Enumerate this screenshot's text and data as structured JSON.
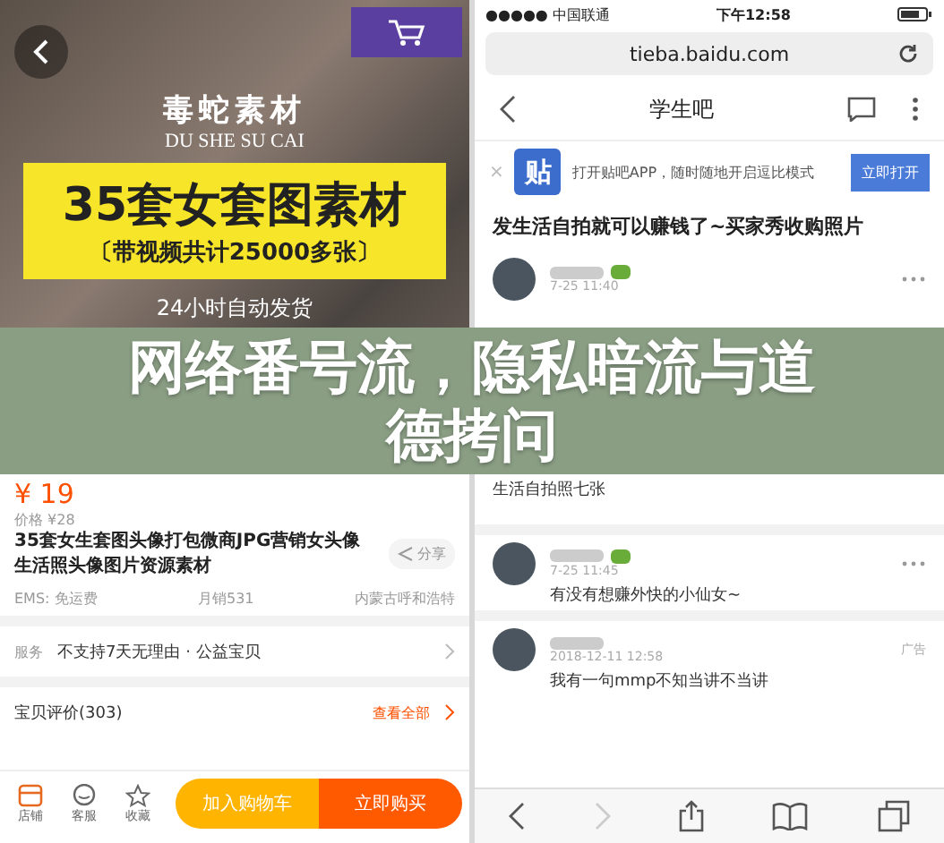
{
  "left_screen": {
    "hero": {
      "brand": "毒蛇素材",
      "brand_latin": "DU SHE SU CAI",
      "headline": "35套女套图素材",
      "subline": "〔带视频共计25000多张〕",
      "shipping": "24小时自动发货"
    },
    "price": "¥ 19",
    "original_price": "价格 ¥28",
    "title": "35套女生套图头像打包微商JPG营销女头像生活照头像图片资源素材",
    "share": "分享",
    "meta": [
      "EMS: 免运费",
      "月销531",
      "内蒙古呼和浩特"
    ],
    "service": {
      "label": "服务",
      "value": "不支持7天无理由 · 公益宝贝"
    },
    "reviews": {
      "label": "宝贝评价(303)",
      "link": "查看全部"
    },
    "tabs": [
      {
        "label": "店铺"
      },
      {
        "label": "客服"
      },
      {
        "label": "收藏"
      }
    ],
    "buttons": [
      "加入购物车",
      "立即购买"
    ]
  },
  "right_screen": {
    "status": {
      "carrier": "●●●●● 中国联通",
      "time": "下午12:58"
    },
    "url": "tieba.baidu.com",
    "page_title": "学生吧",
    "app_banner": {
      "close": "×",
      "app_icon": "贴",
      "text": "打开贴吧APP，随时随地开启逗比模式",
      "button": "立即打开"
    },
    "post_title": "发生活自拍就可以赚钱了~买家秀收购照片",
    "posts": [
      {
        "time": "7-25 11:40",
        "lines": [
          "生活自拍照七张"
        ]
      },
      {
        "time": "7-25 11:45",
        "lines": [
          "有没有想赚外快的小仙女~"
        ]
      },
      {
        "time": "2018-12-11 12:58",
        "tag": "广告",
        "lines": [
          "我有一句mmp不知当讲不当讲"
        ]
      }
    ]
  },
  "overlay_title": [
    "网络番号流，隐私暗流与道",
    "德拷问"
  ]
}
